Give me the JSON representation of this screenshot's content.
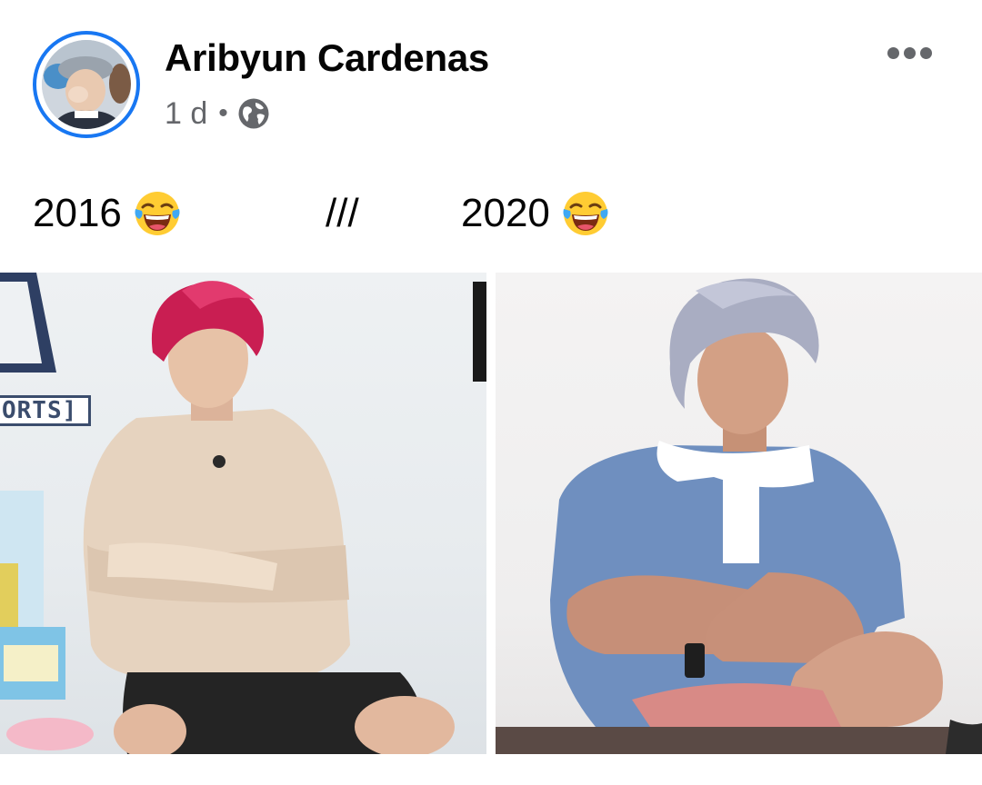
{
  "post": {
    "author_name": "Aribyun Cardenas",
    "timestamp": "1 d",
    "separator": "•",
    "privacy_icon": "globe-icon",
    "more_icon": "more-horizontal-icon"
  },
  "caption": {
    "left_year": "2016",
    "divider": "///",
    "right_year": "2020",
    "emoji": "face-with-tears-of-joy-emoji"
  },
  "photos": {
    "left_sign_text": "ORTS]"
  },
  "colors": {
    "accent": "#1877f2",
    "secondary_text": "#65676b",
    "primary_text": "#050505"
  }
}
